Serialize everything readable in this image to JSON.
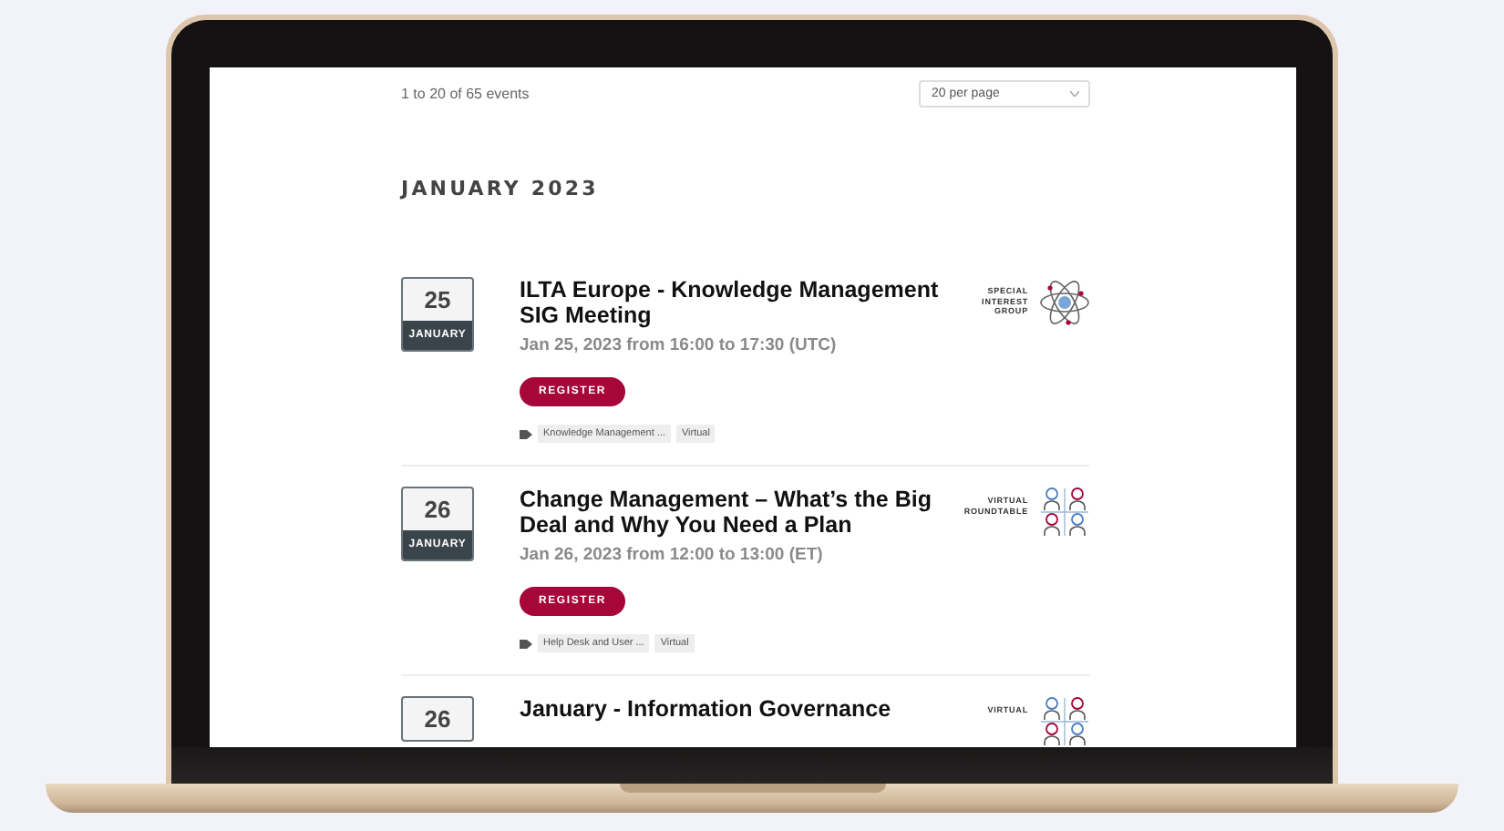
{
  "listing": {
    "summary": "1 to 20 of 65 events",
    "per_page": {
      "value": "20 per page"
    }
  },
  "month_heading": "JANUARY 2023",
  "events": [
    {
      "day": "25",
      "month": "JANUARY",
      "title": "ILTA Europe - Knowledge Management SIG Meeting",
      "datetime": "Jan 25, 2023 from 16:00 to 17:30 (UTC)",
      "register": "REGISTER",
      "tags": [
        "Knowledge Management ...",
        "Virtual"
      ],
      "kind": "sig",
      "badge_lines": [
        "SPECIAL",
        "INTEREST",
        "GROUP"
      ]
    },
    {
      "day": "26",
      "month": "JANUARY",
      "title": "Change Management – What’s the Big Deal and Why You Need a Plan",
      "datetime": "Jan 26, 2023 from 12:00 to 13:00 (ET)",
      "register": "REGISTER",
      "tags": [
        "Help Desk and User ...",
        "Virtual"
      ],
      "kind": "roundtable",
      "badge_lines": [
        "VIRTUAL",
        "ROUNDTABLE"
      ]
    },
    {
      "day": "26",
      "title": "January - Information Governance",
      "kind": "roundtable",
      "badge_lines": [
        "VIRTUAL"
      ]
    }
  ]
}
